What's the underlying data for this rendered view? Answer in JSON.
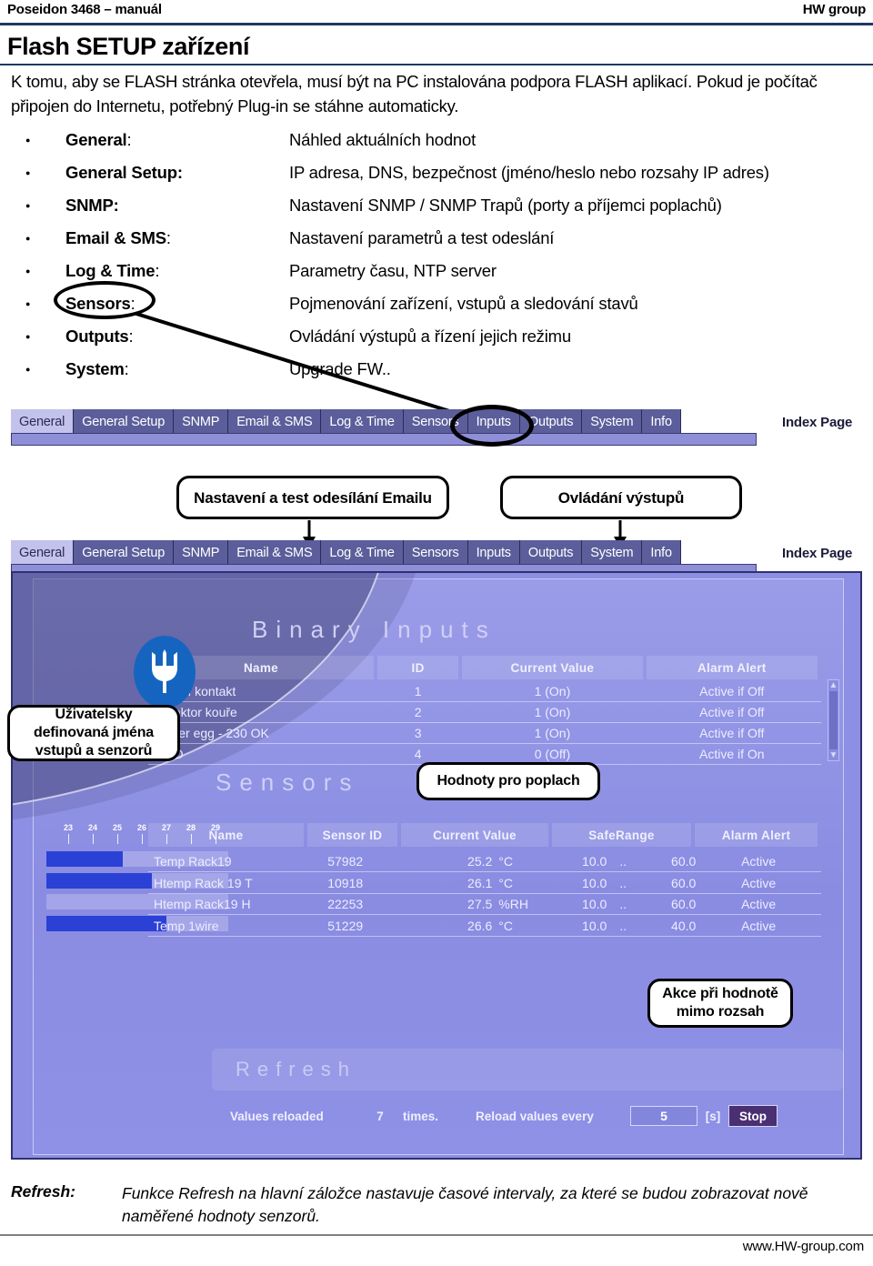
{
  "header": {
    "left": "Poseidon 3468 – manuál",
    "right": "HW group"
  },
  "title": "Flash SETUP zařízení",
  "intro": "K tomu, aby se FLASH stránka otevřela, musí být na PC instalována podpora FLASH aplikací. Pokud je počítač připojen do Internetu, potřebný Plug-in se stáhne automaticky.",
  "bullets": [
    {
      "term": "General",
      "colon": ":",
      "desc": "Náhled aktuálních hodnot"
    },
    {
      "term": "General Setup:",
      "colon": "",
      "desc": "IP adresa, DNS, bezpečnost (jméno/heslo nebo rozsahy IP adres)"
    },
    {
      "term": "SNMP:",
      "colon": "",
      "desc": "Nastavení SNMP / SNMP Trapů (porty a příjemci poplachů)"
    },
    {
      "term": "Email & SMS",
      "colon": ":",
      "desc": "Nastavení parametrů a test odeslání"
    },
    {
      "term": "Log & Time",
      "colon": ":",
      "desc": "Parametry času, NTP server"
    },
    {
      "term": "Sensors",
      "colon": ":",
      "desc": "Pojmenování zařízení, vstupů a sledování stavů"
    },
    {
      "term": "Outputs",
      "colon": ":",
      "desc": "Ovládání výstupů a řízení jejich režimu"
    },
    {
      "term": "System",
      "colon": ":",
      "desc": "Upgrade FW.."
    }
  ],
  "tabs_top": {
    "items": [
      "General",
      "General Setup",
      "SNMP",
      "Email & SMS",
      "Log & Time",
      "Sensors",
      "Inputs",
      "Outputs",
      "System",
      "Info"
    ],
    "active": "General",
    "index_page": "Index Page"
  },
  "tabs_bottom": {
    "items": [
      "General",
      "General Setup",
      "SNMP",
      "Email & SMS",
      "Log & Time",
      "Sensors",
      "Inputs",
      "Outputs",
      "System",
      "Info"
    ],
    "active": "General",
    "index_page": "Index Page"
  },
  "callouts": {
    "email": "Nastavení a test odesílání Emailu",
    "outputs": "Ovládání výstupů",
    "names": "Uživatelsky\ndefinovaná jména\nvstupů a senzorů",
    "alarm_values": "Hodnoty pro poplach",
    "out_of_range": "Akce při hodnotě\nmimo rozsah"
  },
  "flash": {
    "binary_inputs": {
      "title": "Binary Inputs",
      "columns": [
        "Name",
        "ID",
        "Current Value",
        "Alarm Alert"
      ],
      "rows": [
        {
          "name": "Dveřní kontakt",
          "id": "1",
          "value": "1 (On)",
          "alert": "Active if Off"
        },
        {
          "name": "Detektor kouře",
          "id": "2",
          "value": "1 (On)",
          "alert": "Active if Off"
        },
        {
          "name": "Power egg - 230 OK",
          "id": "3",
          "value": "1 (On)",
          "alert": "Active if Off"
        },
        {
          "name": "RFID",
          "id": "4",
          "value": "0 (Off)",
          "alert": "Active if On"
        }
      ]
    },
    "sensors": {
      "title": "Sensors",
      "columns": [
        "Name",
        "Sensor ID",
        "Current Value",
        "SafeRange",
        "Alarm Alert"
      ],
      "scale_ticks": [
        "23",
        "24",
        "25",
        "26",
        "27",
        "28",
        "29"
      ],
      "rows": [
        {
          "name": "Temp Rack19",
          "sensor_id": "57982",
          "value": "25.2",
          "unit": "°C",
          "range_min": "10.0",
          "range_sep": "..",
          "range_max": "60.0",
          "alert": "Active",
          "bar_pct": 42
        },
        {
          "name": "Htemp Rack 19 T",
          "sensor_id": "10918",
          "value": "26.1",
          "unit": "°C",
          "range_min": "10.0",
          "range_sep": "..",
          "range_max": "60.0",
          "alert": "Active",
          "bar_pct": 58
        },
        {
          "name": "Htemp Rack19 H",
          "sensor_id": "22253",
          "value": "27.5",
          "unit": "%RH",
          "range_min": "10.0",
          "range_sep": "..",
          "range_max": "60.0",
          "alert": "Active",
          "bar_pct": 0
        },
        {
          "name": "Temp 1wire",
          "sensor_id": "51229",
          "value": "26.6",
          "unit": "°C",
          "range_min": "10.0",
          "range_sep": "..",
          "range_max": "40.0",
          "alert": "Active",
          "bar_pct": 66
        }
      ]
    },
    "refresh": {
      "word": "Refresh",
      "prefix": "Values reloaded",
      "count": "7",
      "mid": "times.",
      "every_label": "Reload values every",
      "interval": "5",
      "unit": "[s]",
      "stop_label": "Stop"
    }
  },
  "footnote": {
    "term": "Refresh:",
    "text": "Funkce Refresh na hlavní záložce nastavuje časové intervaly, za které se budou zobrazovat nově naměřené hodnoty senzorů."
  },
  "footer_url": "www.HW-group.com",
  "colors": {
    "rule": "#1f3864",
    "tab_bg": "#5b5e9b",
    "tab_active": "#c2c2ec",
    "flash_bg": "#8d8fe4",
    "bar_fill": "#2b41d6",
    "trident_badge": "#1565c0"
  }
}
